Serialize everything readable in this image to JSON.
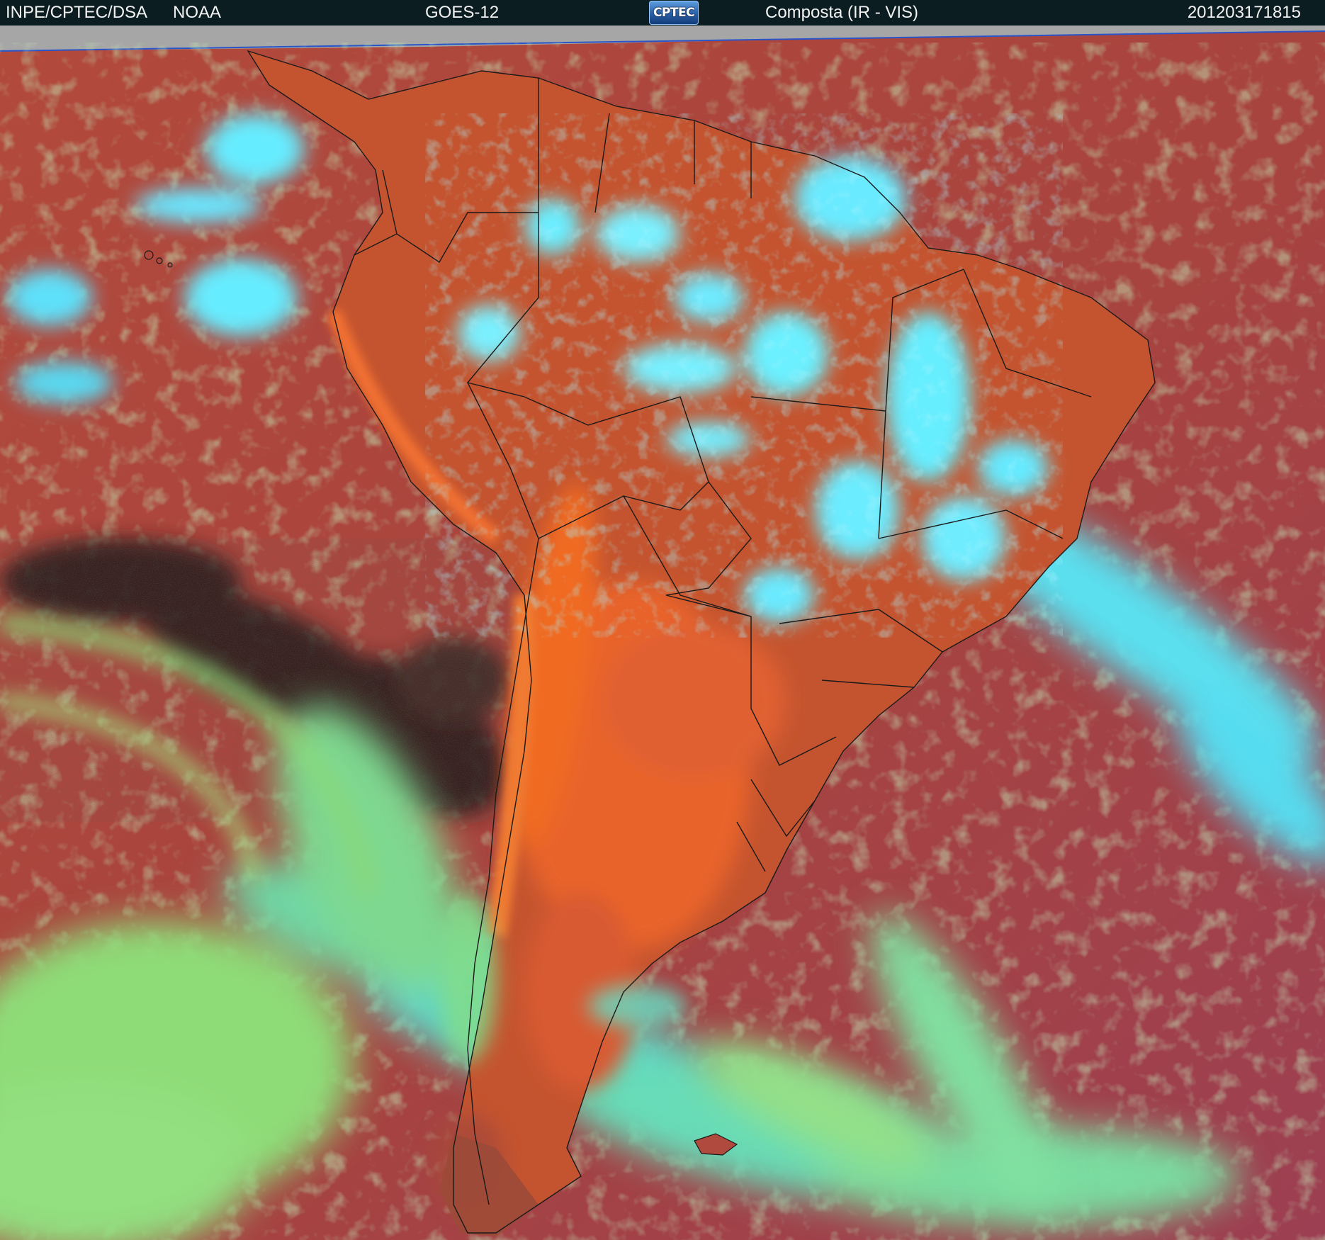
{
  "header": {
    "institution": "INPE/CPTEC/DSA",
    "agency": "NOAA",
    "satellite": "GOES-12",
    "logo_text": "CPTEC",
    "product": "Composta (IR - VIS)",
    "timestamp": "201203171815"
  },
  "colors": {
    "header_bg": "#0c1d22",
    "header_text": "#f2f2f2",
    "ocean_clear": "#b04a3e",
    "land_warm": "#e0602a",
    "low_cloud": "#8ee07a",
    "high_cloud": "#56e8f8",
    "cold_clear": "#2a1e1c",
    "no_data": "#a6a6a6",
    "borders": "#1a1a1a"
  }
}
